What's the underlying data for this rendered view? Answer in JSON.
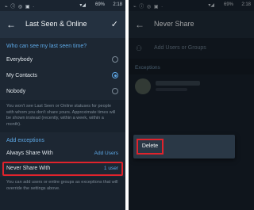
{
  "status": {
    "time": "2:18",
    "battery": "69%"
  },
  "left": {
    "title": "Last Seen & Online",
    "question": "Who can see my last seen time?",
    "options": [
      {
        "label": "Everybody",
        "selected": false
      },
      {
        "label": "My Contacts",
        "selected": true
      },
      {
        "label": "Nobody",
        "selected": false
      }
    ],
    "hint": "You won't see Last Seen or Online statuses for people with whom you don't share yours. Approximate times will be shown instead (recently, within a week, within a month).",
    "exceptions_header": "Add exceptions",
    "always_share": {
      "label": "Always Share With",
      "value": "Add Users"
    },
    "never_share": {
      "label": "Never Share With",
      "value": "1 user"
    },
    "note": "You can add users or entire groups as exceptions that will override the settings above."
  },
  "right": {
    "title": "Never Share",
    "add_label": "Add Users or Groups",
    "exceptions_label": "Exceptions",
    "menu_item": "Delete"
  },
  "colors": {
    "accent": "#5da8e6",
    "highlight": "#e0232c"
  }
}
